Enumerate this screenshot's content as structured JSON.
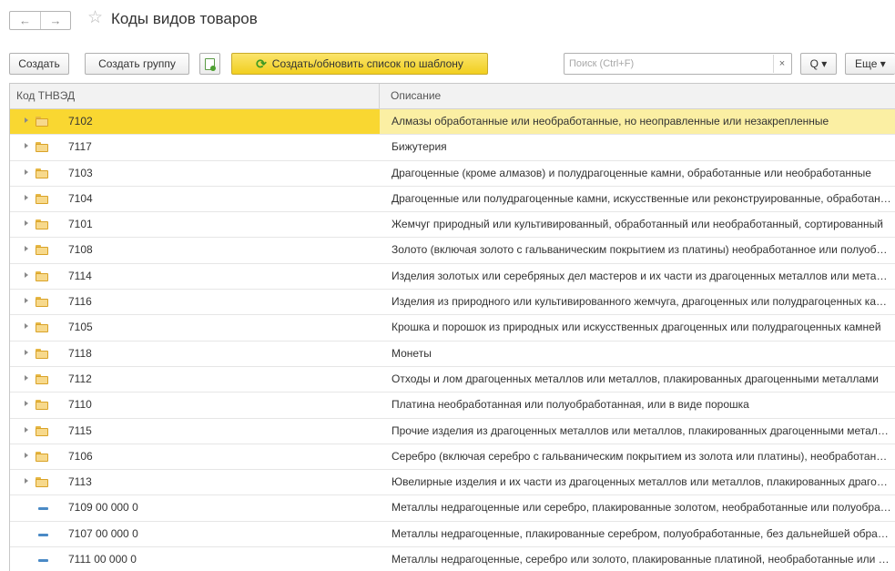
{
  "window": {
    "back_icon": "arrow-left-icon",
    "forward_icon": "arrow-right-icon",
    "favorite_icon": "star-outline-icon",
    "title": "Коды видов товаров"
  },
  "toolbar": {
    "create_label": "Создать",
    "create_group_label": "Создать группу",
    "template_label": "Создать/обновить список по шаблону",
    "search_placeholder": "Поиск (Ctrl+F)",
    "clear_label": "×",
    "search_label": "Q ▾",
    "more_label": "Еще ▾"
  },
  "table": {
    "columns": {
      "code": "Код ТНВЭД",
      "description": "Описание"
    },
    "rows": [
      {
        "code": "7102",
        "description": "Алмазы обработанные или необработанные, но неоправленные или незакрепленные",
        "kind": "group",
        "selected": true
      },
      {
        "code": "7117",
        "description": "Бижутерия",
        "kind": "group"
      },
      {
        "code": "7103",
        "description": "Драгоценные (кроме алмазов) и полудрагоценные камни, обработанные или необработанные",
        "kind": "group"
      },
      {
        "code": "7104",
        "description": "Драгоценные или полудрагоценные камни, искусственные или реконструированные, обработанные",
        "kind": "group"
      },
      {
        "code": "7101",
        "description": "Жемчуг природный или культивированный, обработанный или необработанный, сортированный",
        "kind": "group"
      },
      {
        "code": "7108",
        "description": "Золото (включая золото с гальваническим покрытием из платины) необработанное или полуобработанное",
        "kind": "group"
      },
      {
        "code": "7114",
        "description": "Изделия золотых или серебряных дел мастеров и их части из драгоценных металлов или металлов",
        "kind": "group"
      },
      {
        "code": "7116",
        "description": "Изделия из природного или культивированного жемчуга, драгоценных или полудрагоценных камней",
        "kind": "group"
      },
      {
        "code": "7105",
        "description": "Крошка и порошок из природных или искусственных драгоценных или полудрагоценных камней",
        "kind": "group"
      },
      {
        "code": "7118",
        "description": "Монеты",
        "kind": "group"
      },
      {
        "code": "7112",
        "description": "Отходы и лом драгоценных металлов или металлов, плакированных драгоценными металлами",
        "kind": "group"
      },
      {
        "code": "7110",
        "description": "Платина необработанная или полуобработанная, или в виде порошка",
        "kind": "group"
      },
      {
        "code": "7115",
        "description": "Прочие изделия из драгоценных металлов или металлов, плакированных драгоценными металлами",
        "kind": "group"
      },
      {
        "code": "7106",
        "description": "Серебро (включая серебро с гальваническим покрытием из золота или платины), необработанное",
        "kind": "group"
      },
      {
        "code": "7113",
        "description": "Ювелирные изделия и их части из драгоценных металлов или металлов, плакированных драгоценными",
        "kind": "group"
      },
      {
        "code": "7109 00 000 0",
        "description": "Металлы недрагоценные или серебро, плакированные золотом, необработанные или полуобработанные",
        "kind": "item"
      },
      {
        "code": "7107 00 000 0",
        "description": "Металлы недрагоценные, плакированные серебром, полуобработанные, без дальнейшей обработки",
        "kind": "item"
      },
      {
        "code": "7111 00 000 0",
        "description": "Металлы недрагоценные, серебро или золото, плакированные платиной, необработанные или полуобработанные",
        "kind": "item"
      }
    ]
  },
  "colors": {
    "selection_code": "#f9d731",
    "selection_row": "#fbefa3",
    "accent_button": "#f4d530",
    "folder": "#f7d98c",
    "item_marker": "#4a8ac6"
  }
}
